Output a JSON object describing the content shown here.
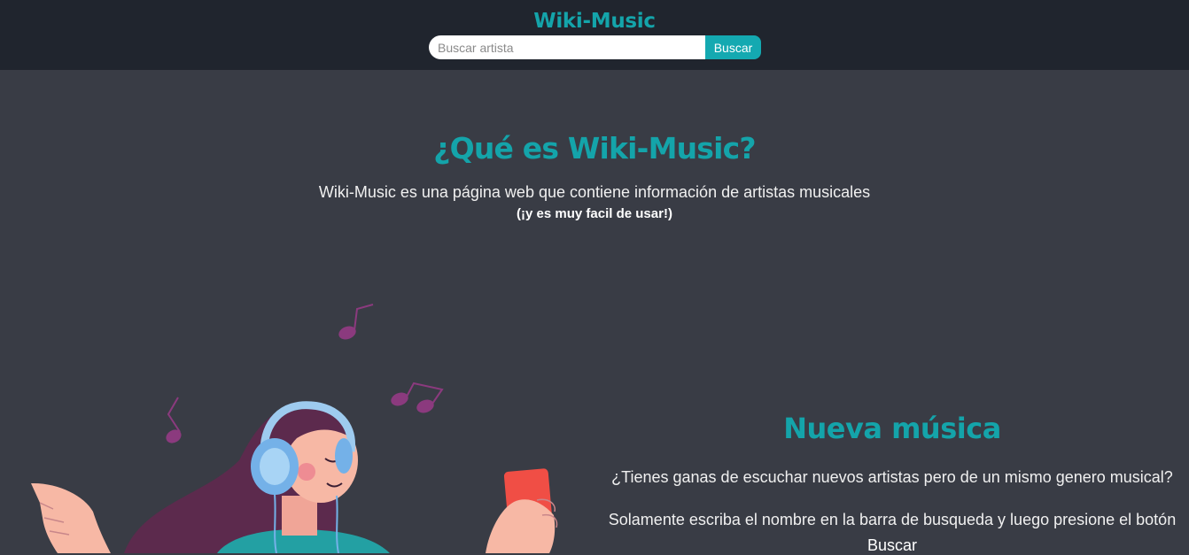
{
  "header": {
    "brand": "Wiki-Music",
    "search": {
      "placeholder": "Buscar artista",
      "value": "",
      "button_label": "Buscar"
    }
  },
  "about": {
    "title": "¿Qué es Wiki-Music?",
    "description": "Wiki-Music es una página web que contiene información de artistas musicales",
    "note": "(¡y es muy facil de usar!)"
  },
  "new_music": {
    "title": "Nueva música",
    "question": "¿Tienes ganas de escuchar nuevos artistas pero de un mismo genero musical?",
    "instruction": "Solamente escriba el nombre en la barra de busqueda y luego presione el botón",
    "button_word": "Buscar"
  },
  "colors": {
    "accent": "#14a4aa",
    "header_bg": "#20252e",
    "page_bg": "#393c45",
    "music_note": "#8b3a7e",
    "phone": "#f04e45"
  }
}
